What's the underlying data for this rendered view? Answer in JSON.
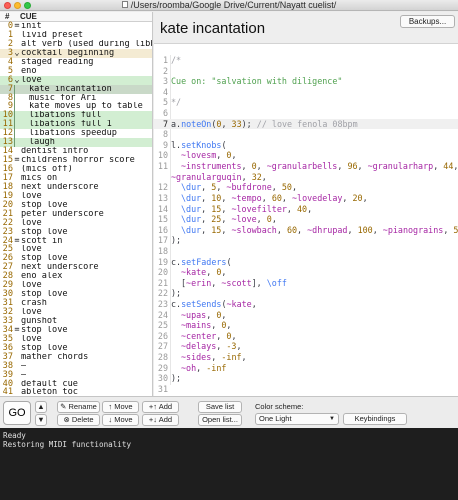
{
  "window": {
    "title": "/Users/roomba/Google Drive/Current/Nayatt cuelist/"
  },
  "cue_list": {
    "headers": {
      "num": "#",
      "cue": "CUE"
    },
    "rows": [
      {
        "num": "0",
        "marker": "=",
        "name": "init"
      },
      {
        "num": "1",
        "marker": "",
        "name": "livid preset"
      },
      {
        "num": "2",
        "marker": "",
        "name": "alt verb (used during libby section)"
      },
      {
        "num": "3",
        "marker": "⌄",
        "name": "cocktail beginning",
        "state": "current"
      },
      {
        "num": "4",
        "marker": "",
        "name": "staged reading"
      },
      {
        "num": "5",
        "marker": "",
        "name": "eno"
      },
      {
        "num": "6",
        "marker": "⌄",
        "name": "love",
        "state": "group"
      },
      {
        "num": "7",
        "marker": "",
        "name": "kate incantation",
        "state": "selected",
        "indent": true
      },
      {
        "num": "8",
        "marker": "",
        "name": "music for Ari",
        "indent": true
      },
      {
        "num": "9",
        "marker": "",
        "name": "kate moves up to table",
        "indent": true
      },
      {
        "num": "10",
        "marker": "",
        "name": "libations full",
        "state": "group",
        "indent": true
      },
      {
        "num": "11",
        "marker": "",
        "name": "libations full 1",
        "state": "group",
        "indent": true
      },
      {
        "num": "12",
        "marker": "",
        "name": "libations speedup",
        "indent": true
      },
      {
        "num": "13",
        "marker": "",
        "name": "laugh",
        "state": "group",
        "indent": true
      },
      {
        "num": "14",
        "marker": "",
        "name": "dentist intro"
      },
      {
        "num": "15",
        "marker": "=",
        "name": "childrens horror score"
      },
      {
        "num": "16",
        "marker": "",
        "name": "(mics off)"
      },
      {
        "num": "17",
        "marker": "",
        "name": "mics on"
      },
      {
        "num": "18",
        "marker": "",
        "name": "next underscore"
      },
      {
        "num": "19",
        "marker": "",
        "name": "love"
      },
      {
        "num": "20",
        "marker": "",
        "name": "stop love"
      },
      {
        "num": "21",
        "marker": "",
        "name": "peter underscore"
      },
      {
        "num": "22",
        "marker": "",
        "name": "love"
      },
      {
        "num": "23",
        "marker": "",
        "name": "stop love"
      },
      {
        "num": "24",
        "marker": "=",
        "name": "scott in"
      },
      {
        "num": "25",
        "marker": "",
        "name": "love"
      },
      {
        "num": "26",
        "marker": "",
        "name": "stop love"
      },
      {
        "num": "27",
        "marker": "",
        "name": "next underscore"
      },
      {
        "num": "28",
        "marker": "",
        "name": "eno alex"
      },
      {
        "num": "29",
        "marker": "",
        "name": "love"
      },
      {
        "num": "30",
        "marker": "",
        "name": "stop love"
      },
      {
        "num": "31",
        "marker": "",
        "name": "crash"
      },
      {
        "num": "32",
        "marker": "",
        "name": "love"
      },
      {
        "num": "33",
        "marker": "",
        "name": "gunshot"
      },
      {
        "num": "34",
        "marker": "=",
        "name": "stop love"
      },
      {
        "num": "35",
        "marker": "",
        "name": "love"
      },
      {
        "num": "36",
        "marker": "",
        "name": "stop love"
      },
      {
        "num": "37",
        "marker": "",
        "name": "mather chords"
      },
      {
        "num": "38",
        "marker": "",
        "name": "—"
      },
      {
        "num": "39",
        "marker": "",
        "name": "—"
      },
      {
        "num": "40",
        "marker": "",
        "name": "default cue"
      },
      {
        "num": "41",
        "marker": "",
        "name": "ableton toc"
      }
    ]
  },
  "editor": {
    "cue_title": "kate incantation",
    "backups_label": "Backups...",
    "highlighted_line": 7,
    "lines": [
      {
        "n": "1",
        "text": "/*",
        "cls": "cmt"
      },
      {
        "n": "2",
        "text": ""
      },
      {
        "n": "3",
        "text": "Cue on: \"salvation with diligence\"",
        "cls": "str"
      },
      {
        "n": "4",
        "text": ""
      },
      {
        "n": "5",
        "text": "*/",
        "cls": "cmt"
      },
      {
        "n": "6",
        "text": ""
      },
      {
        "n": "7",
        "text": "a.noteOn(0, 33); // love fenola 08bpm"
      },
      {
        "n": "8",
        "text": ""
      },
      {
        "n": "9",
        "text": "l.setKnobs("
      },
      {
        "n": "10",
        "text": "~lovesm, 0,",
        "indent": true
      },
      {
        "n": "11",
        "text": "~instruments, 0, ~granularbells, 96, ~granularharp, 44,",
        "indent": true
      },
      {
        "n": "",
        "text": "~granularguqin, 32,"
      },
      {
        "n": "12",
        "text": "\\dur, 5, ~bufdrone, 50,",
        "indent": true
      },
      {
        "n": "13",
        "text": "\\dur, 10, ~tempo, 60, ~lovedelay, 20,",
        "indent": true
      },
      {
        "n": "14",
        "text": "\\dur, 15, ~lovefilter, 40,",
        "indent": true
      },
      {
        "n": "15",
        "text": "\\dur, 25, ~love, 0,",
        "indent": true
      },
      {
        "n": "16",
        "text": "\\dur, 15, ~slowbach, 60, ~dhrupad, 100, ~pianograins, 50",
        "indent": true
      },
      {
        "n": "17",
        "text": ");"
      },
      {
        "n": "18",
        "text": ""
      },
      {
        "n": "19",
        "text": "c.setFaders("
      },
      {
        "n": "20",
        "text": "~kate, 0,",
        "indent": true
      },
      {
        "n": "21",
        "text": "[~erin, ~scott], \\off",
        "indent": true
      },
      {
        "n": "22",
        "text": ");"
      },
      {
        "n": "23",
        "text": "c.setSends(~kate,"
      },
      {
        "n": "24",
        "text": "~upas, 0,",
        "indent": true
      },
      {
        "n": "25",
        "text": "~mains, 0,",
        "indent": true
      },
      {
        "n": "26",
        "text": "~center, 0,",
        "indent": true
      },
      {
        "n": "27",
        "text": "~delays, -3,",
        "indent": true
      },
      {
        "n": "28",
        "text": "~sides, -inf,",
        "indent": true
      },
      {
        "n": "29",
        "text": "~oh, -inf",
        "indent": true
      },
      {
        "n": "30",
        "text": ");"
      },
      {
        "n": "31",
        "text": ""
      }
    ]
  },
  "toolbar": {
    "go": "GO",
    "up_arrow": "▲",
    "down_arrow": "▼",
    "rename": "✎ Rename",
    "delete": "⊗ Delete",
    "move_up": "↑ Move",
    "move_down": "↓ Move",
    "add_above": "+↑ Add",
    "add_below": "+↓ Add",
    "save_list": "Save list",
    "open_list": "Open list...",
    "scheme_label": "Color scheme:",
    "scheme_value": "One Light",
    "keybindings": "Keybindings"
  },
  "log": {
    "lines": [
      "Ready",
      "Restoring MIDI functionality"
    ]
  },
  "colors": {
    "selected": "#c9d9c8",
    "group": "#d2eed2",
    "current": "#f4ebd3",
    "log_bg": "#1e1e1e"
  }
}
